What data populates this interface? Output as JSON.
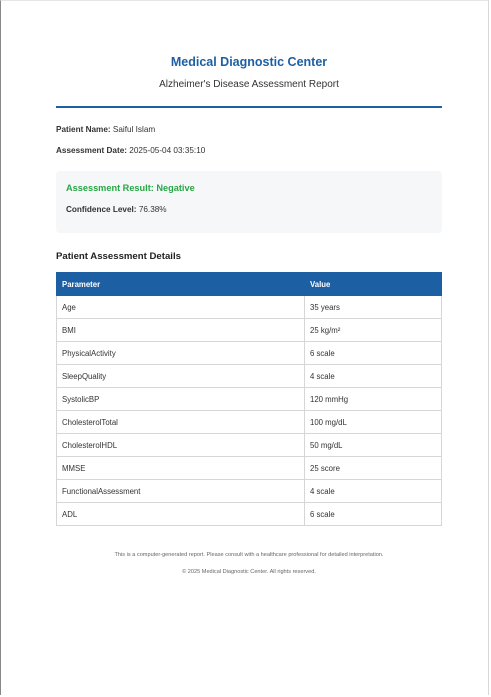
{
  "header": {
    "title": "Medical Diagnostic Center",
    "subtitle": "Alzheimer's Disease Assessment Report"
  },
  "patient": {
    "name_label": "Patient Name:",
    "name_value": "Saiful Islam",
    "date_label": "Assessment Date:",
    "date_value": "2025-05-04 03:35:10"
  },
  "result": {
    "text": "Assessment Result: Negative",
    "confidence_label": "Confidence Level:",
    "confidence_value": "76.38%",
    "result_color": "#28a745"
  },
  "details": {
    "title": "Patient Assessment Details",
    "headers": [
      "Parameter",
      "Value"
    ],
    "rows": [
      {
        "parameter": "Age",
        "value": "35 years"
      },
      {
        "parameter": "BMI",
        "value": "25 kg/m²"
      },
      {
        "parameter": "PhysicalActivity",
        "value": "6 scale"
      },
      {
        "parameter": "SleepQuality",
        "value": "4 scale"
      },
      {
        "parameter": "SystolicBP",
        "value": "120 mmHg"
      },
      {
        "parameter": "CholesterolTotal",
        "value": "100 mg/dL"
      },
      {
        "parameter": "CholesterolHDL",
        "value": "50 mg/dL"
      },
      {
        "parameter": "MMSE",
        "value": "25 score"
      },
      {
        "parameter": "FunctionalAssessment",
        "value": "4 scale"
      },
      {
        "parameter": "ADL",
        "value": "6 scale"
      }
    ]
  },
  "footer": {
    "disclaimer": "This is a computer-generated report. Please consult with a healthcare professional for detailed interpretation.",
    "copyright": "© 2025 Medical Diagnostic Center. All rights reserved."
  },
  "colors": {
    "brand": "#1c5fa3",
    "positive_result": "#28a745"
  }
}
